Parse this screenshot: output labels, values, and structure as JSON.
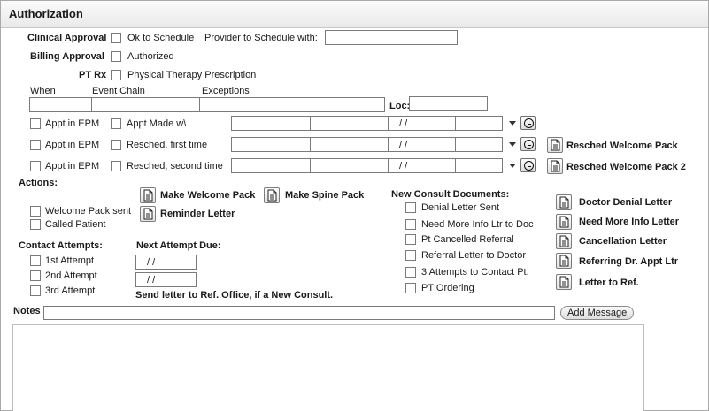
{
  "header": {
    "title": "Authorization"
  },
  "approval": {
    "clinical_label": "Clinical Approval",
    "ok_to_schedule": "Ok to Schedule",
    "provider_label": "Provider to Schedule with:",
    "provider_value": "",
    "billing_label": "Billing Approval",
    "authorized": "Authorized",
    "ptrx_label": "PT Rx",
    "pt_prescription": "Physical Therapy Prescription"
  },
  "event_headers": {
    "when": "When",
    "event_chain": "Event Chain",
    "exceptions": "Exceptions",
    "loc": "Loc:"
  },
  "appt_rows": [
    {
      "epm": "Appt in EPM",
      "label": "Appt Made w\\",
      "date": "/  /",
      "pack": ""
    },
    {
      "epm": "Appt in EPM",
      "label": "Resched, first time",
      "date": "/  /",
      "pack": "Resched Welcome Pack"
    },
    {
      "epm": "Appt in EPM",
      "label": "Resched, second time",
      "date": "/  /",
      "pack": "Resched Welcome Pack 2"
    }
  ],
  "actions": {
    "label": "Actions:",
    "make_welcome_pack": "Make Welcome Pack",
    "make_spine_pack": "Make Spine Pack",
    "reminder_letter": "Reminder Letter",
    "welcome_pack_sent": "Welcome Pack sent",
    "called_patient": "Called Patient"
  },
  "consult": {
    "label": "New Consult Documents:",
    "items": [
      "Denial Letter Sent",
      "Need More Info Ltr to Doc",
      "Pt Cancelled Referral",
      "Referral Letter to Doctor",
      "3 Attempts to Contact Pt.",
      "PT Ordering"
    ],
    "letters": [
      "Doctor Denial Letter",
      "Need More Info Letter",
      "Cancellation Letter",
      "Referring Dr. Appt Ltr",
      "Letter to Ref."
    ]
  },
  "contact": {
    "label": "Contact Attempts:",
    "attempts": [
      "1st Attempt",
      "2nd Attempt",
      "3rd Attempt"
    ],
    "next_label": "Next Attempt Due:",
    "next_dates": [
      "/  /",
      "/  /"
    ],
    "send_note": "Send letter to Ref. Office, if a New Consult."
  },
  "notes": {
    "label": "Notes",
    "value": "",
    "add_message": "Add Message"
  }
}
